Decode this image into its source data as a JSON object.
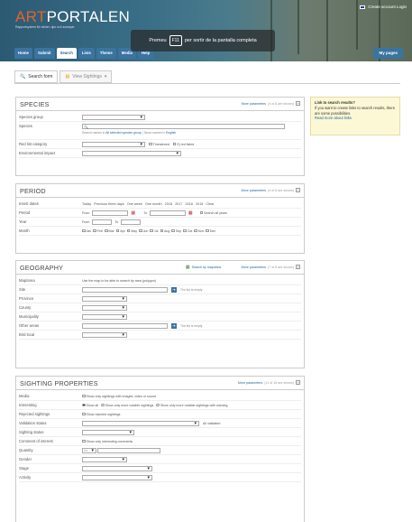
{
  "header": {
    "logo_prefix": "ART",
    "logo_suffix": "PORTALEN",
    "tagline": "Rapportsystem för växter, djur och svampar",
    "account": "Create account  Login"
  },
  "overlay": {
    "before": "Premeu",
    "key": "F11",
    "after": "per sortir de la pantalla completa"
  },
  "nav": {
    "tabs": [
      "Home",
      "Submit",
      "Search",
      "Lists",
      "Theme",
      "Media",
      "Help"
    ],
    "active": "Search",
    "my_pages": "My pages"
  },
  "subtabs": {
    "search_form": "Search form",
    "view_sightings": "View Sightings"
  },
  "linkbox": {
    "title": "Link to search results?",
    "body": "If you want to create links to search results, there are some possibilities.",
    "more": "Read more about links"
  },
  "species": {
    "title": "SPECIES",
    "more": "More parameters",
    "more_count": "(4 of 8 are shown)",
    "rows": {
      "species_group": "Species group",
      "species": "Species",
      "species_hint": "Search names in",
      "species_hint_link": "All selected species group",
      "taxon_names": "Taxon names in",
      "taxon_lang": "English",
      "red_list": "Red list category",
      "threatened": "Threatened",
      "not_listed": "Ej red listed",
      "env_impact": "Environmental impact"
    }
  },
  "period": {
    "title": "PERIOD",
    "more": "More parameters",
    "more_count": "(4 of 8 are shown)",
    "insert_dates": "Insert dates",
    "date_links": [
      "Today",
      "Previous three days",
      "One week",
      "One month",
      "2018",
      "2017",
      "2016",
      "2015",
      "Clear"
    ],
    "period": "Period",
    "from": "From",
    "to": "To",
    "search_all_years": "Search all years",
    "year": "Year",
    "month": "Month",
    "months": [
      "Jan",
      "Feb",
      "Mar",
      "Apr",
      "May",
      "Jun",
      "Jul",
      "Aug",
      "Sep",
      "Oct",
      "Nov",
      "Dec"
    ]
  },
  "geography": {
    "title": "GEOGRAPHY",
    "search_by_map": "Search by map/area",
    "more": "More parameters",
    "more_count": "(7 of 8 are shown)",
    "map_area": "Map/area",
    "map_area_hint": "Use the map to be able to search by area (polygon)",
    "site": "Site",
    "list_empty": "The list is empty",
    "province": "Province",
    "county": "County",
    "municipality": "Municipality",
    "other_areas": "Other areas",
    "list_empty2": "The list is empty",
    "bird_local": "Bird local"
  },
  "sighting": {
    "title": "SIGHTING PROPERTIES",
    "more": "More parameters",
    "more_count": "(11 of 16 are shown)",
    "media": "Media",
    "media_opt": "Show only sightings with images, video or sound",
    "interesting": "Interesting",
    "interesting_all": "Show all",
    "interesting_opt1": "Show only more notable sightings",
    "interesting_opt2": "Show only more notable sightings with warning",
    "rejected": "Rejected sightings",
    "rejected_opt": "Show rejected sightings",
    "validation": "Validation status",
    "validation_val": "All validated",
    "status": "Sighting status",
    "comment": "Comment of interest",
    "comment_opt": "Show only interesting comments",
    "quantity": "Quantity",
    "quantity_op": ">=",
    "gender": "Gender",
    "stage": "Stage",
    "activity": "Activity"
  }
}
